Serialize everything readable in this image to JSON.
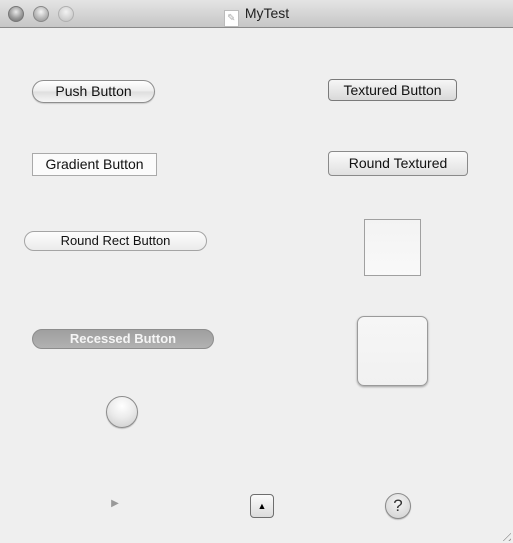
{
  "window": {
    "title": "MyTest",
    "title_icon": "document-icon",
    "controls": [
      "close",
      "minimize",
      "zoom"
    ]
  },
  "buttons": {
    "push": "Push Button",
    "gradient": "Gradient Button",
    "round_rect": "Round Rect Button",
    "recessed": "Recessed Button",
    "textured": "Textured Button",
    "round_textured": "Round Textured",
    "disclosure_triangle_glyph": "▶",
    "disclosure_button_glyph": "▲",
    "help_glyph": "?"
  }
}
